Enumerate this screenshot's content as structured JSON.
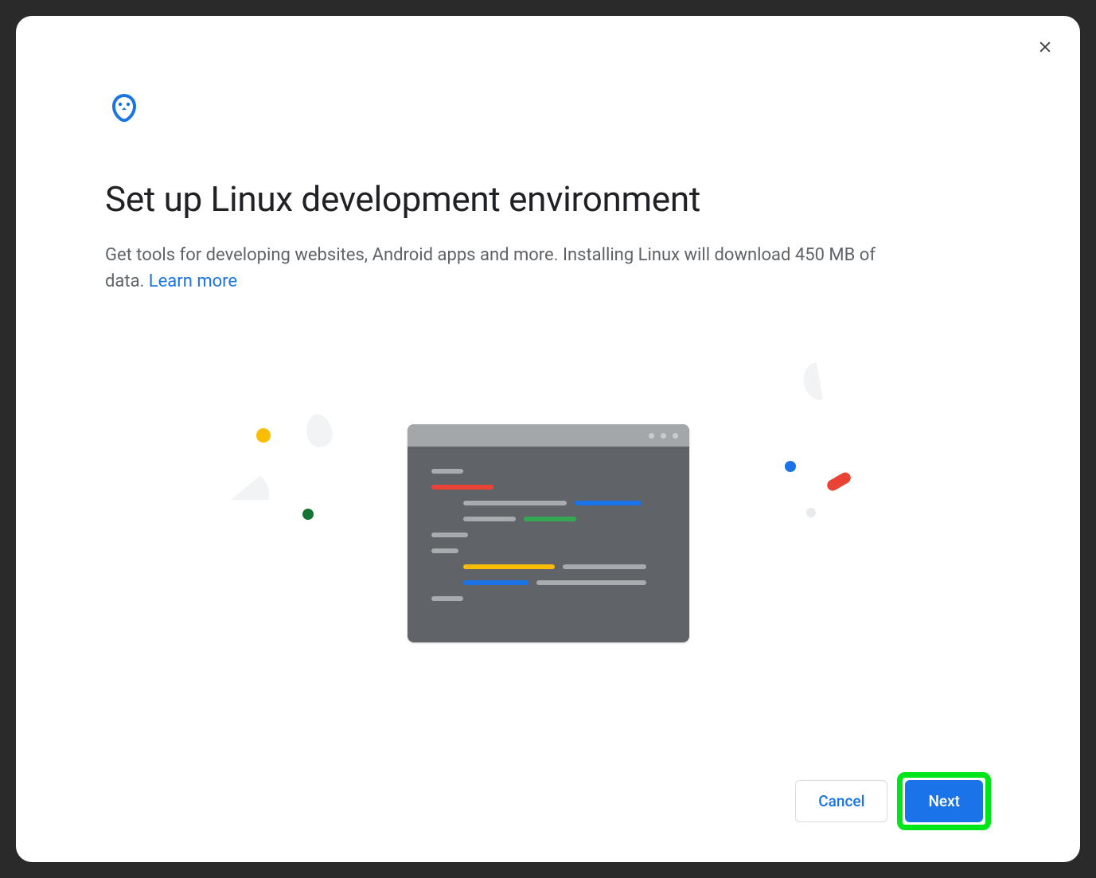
{
  "dialog": {
    "title": "Set up Linux development environment",
    "description_text": "Get tools for developing websites, Android apps and more. Installing Linux will download 450 MB of data. ",
    "learn_more_label": "Learn more"
  },
  "footer": {
    "cancel_label": "Cancel",
    "next_label": "Next"
  },
  "colors": {
    "primary": "#1a73e8",
    "red": "#ea4335",
    "yellow": "#fbbc04",
    "green": "#137333"
  }
}
